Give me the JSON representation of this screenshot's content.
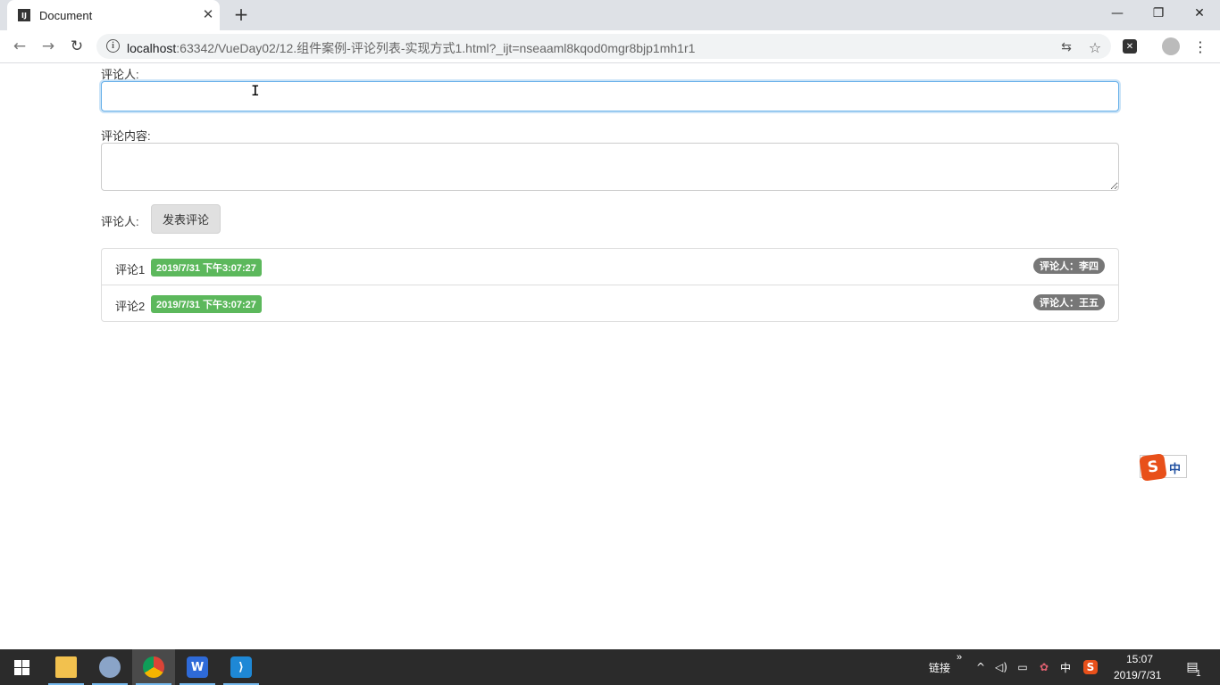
{
  "browser": {
    "tab_title": "Document",
    "tab_favicon": "IJ",
    "url_host": "localhost",
    "url_rest": ":63342/VueDay02/12.组件案例-评论列表-实现方式1.html?_ijt=nseaaml8kqod0mgr8bjp1mh1r1"
  },
  "form": {
    "author_label": "评论人:",
    "author_value": "",
    "content_label": "评论内容:",
    "content_value": "",
    "submit_row_label": "评论人:",
    "submit_button": "发表评论"
  },
  "comments": [
    {
      "text": "评论1",
      "time": "2019/7/31 下午3:07:27",
      "author": "评论人：李四"
    },
    {
      "text": "评论2",
      "time": "2019/7/31 下午3:07:27",
      "author": "评论人：王五"
    }
  ],
  "ime": {
    "mode": "中"
  },
  "taskbar": {
    "links_label": "链接",
    "ime_tray": "中",
    "clock_time": "15:07",
    "clock_date": "2019/7/31",
    "notifications": "1"
  },
  "colors": {
    "time_badge": "#5cb85c",
    "author_badge": "#777777",
    "focus_border": "#66afe9"
  }
}
